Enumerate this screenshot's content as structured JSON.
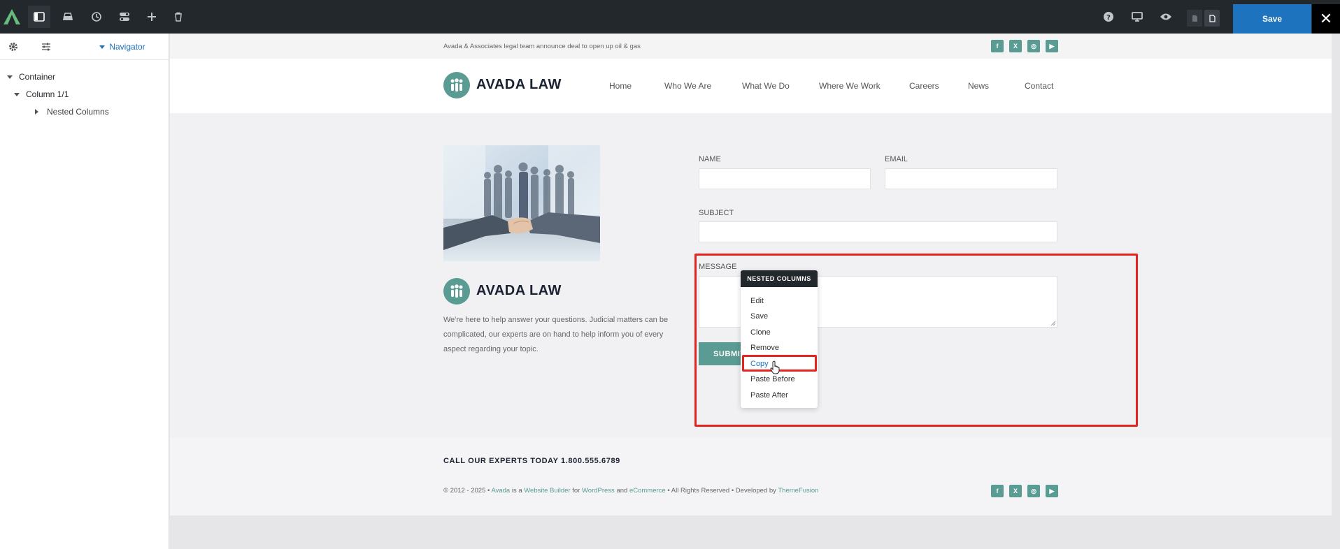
{
  "toolbar": {
    "save_label": "Save",
    "close_glyph": "✕",
    "icons": [
      "avada-logo-icon",
      "sidebar-toggle-icon",
      "library-icon",
      "history-icon",
      "toggles-icon",
      "add-icon",
      "trash-icon",
      "help-icon",
      "desktop-icon",
      "preview-icon",
      "page-icon",
      "page-active-icon"
    ]
  },
  "sidebar": {
    "nav_label": "Navigator",
    "tree": [
      {
        "label": "Container",
        "level": 0,
        "expanded": true
      },
      {
        "label": "Column 1/1",
        "level": 1,
        "expanded": true
      },
      {
        "label": "Nested Columns",
        "level": 2,
        "expanded": false
      }
    ]
  },
  "site": {
    "announcement": "Avada & Associates legal team announce deal to open up oil & gas",
    "brand": "AVADA LAW",
    "nav": [
      "Home",
      "Who We Are",
      "What We Do",
      "Where We Work",
      "Careers",
      "News",
      "Contact"
    ],
    "social": [
      "f",
      "X",
      "◎",
      "▶"
    ]
  },
  "content": {
    "brand": "AVADA LAW",
    "intro_lines": [
      "We're here to help answer your questions. Judicial matters can be",
      "complicated, our experts are on hand to help inform you of every",
      "aspect regarding your topic."
    ]
  },
  "form": {
    "name_label": "NAME",
    "email_label": "EMAIL",
    "subject_label": "SUBJECT",
    "message_label": "MESSAGE",
    "submit_label": "SUBMIT"
  },
  "context_menu": {
    "title": "NESTED COLUMNS",
    "items": [
      "Edit",
      "Save",
      "Clone",
      "Remove",
      "Copy",
      "Paste Before",
      "Paste After"
    ],
    "highlighted": "Copy"
  },
  "footer": {
    "cta": "CALL OUR EXPERTS TODAY 1.800.555.6789",
    "copyright": {
      "prefix": "© 2012 - 2025 • ",
      "avada": "Avada",
      "is_a": " is a ",
      "website_builder": "Website Builder",
      "for": " for ",
      "wordpress": "WordPress",
      "and": " and ",
      "ecommerce": "eCommerce",
      "rights": " • All Rights Reserved • Developed by ",
      "themefusion": "ThemeFusion"
    }
  },
  "colors": {
    "accent": "#5a9b93",
    "toolbar": "#23282d",
    "save": "#1e73be",
    "highlight": "#e5231f",
    "copy_link": "#1e73be"
  }
}
